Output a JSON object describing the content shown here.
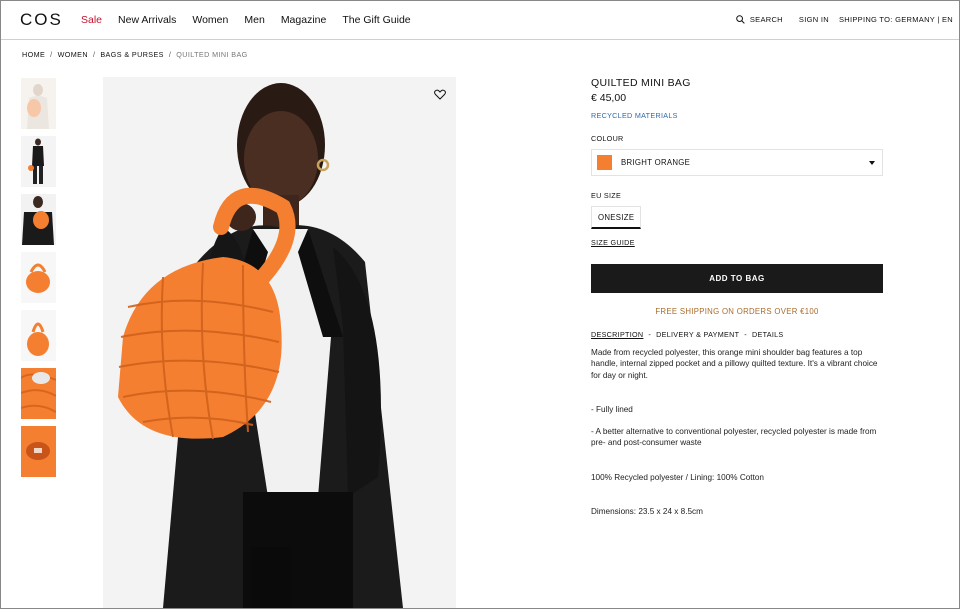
{
  "header": {
    "logo": "COS",
    "nav": [
      "Sale",
      "New Arrivals",
      "Women",
      "Men",
      "Magazine",
      "The Gift Guide"
    ],
    "search_label": "SEARCH",
    "signin_label": "SIGN IN",
    "shipping_to": "SHIPPING TO: GERMANY | EN"
  },
  "breadcrumb": [
    "HOME",
    "WOMEN",
    "BAGS & PURSES",
    "QUILTED MINI BAG"
  ],
  "product": {
    "title": "QUILTED MINI BAG",
    "price": "€ 45,00",
    "tag": "RECYCLED MATERIALS",
    "colour_label": "COLOUR",
    "colour_value": "BRIGHT ORANGE",
    "colour_hex": "#f47f30",
    "size_label": "EU SIZE",
    "size_value": "ONESIZE",
    "size_guide": "SIZE GUIDE",
    "add_to_bag": "ADD TO BAG",
    "shipping_note": "FREE SHIPPING ON ORDERS OVER €100"
  },
  "tabs": [
    "DESCRIPTION",
    "DELIVERY & PAYMENT",
    "DETAILS"
  ],
  "description": {
    "para1": "Made from recycled polyester, this orange mini shoulder bag features a top handle, internal zipped pocket and a pillowy quilted texture. It's a vibrant choice for day or night.",
    "bullet1": "- Fully lined",
    "bullet2": "- A better alternative to conventional polyester, recycled polyester is made from pre- and post-consumer waste",
    "composition": "100% Recycled polyester / Lining: 100% Cotton",
    "dimensions": "Dimensions: 23.5 x 24 x 8.5cm"
  },
  "colors": {
    "accent_sale": "#c8102e",
    "link_blue": "#2e6aa8",
    "shipping_note": "#a86b2a",
    "button_dark": "#1a1a1a",
    "bag_orange": "#f47f30"
  }
}
